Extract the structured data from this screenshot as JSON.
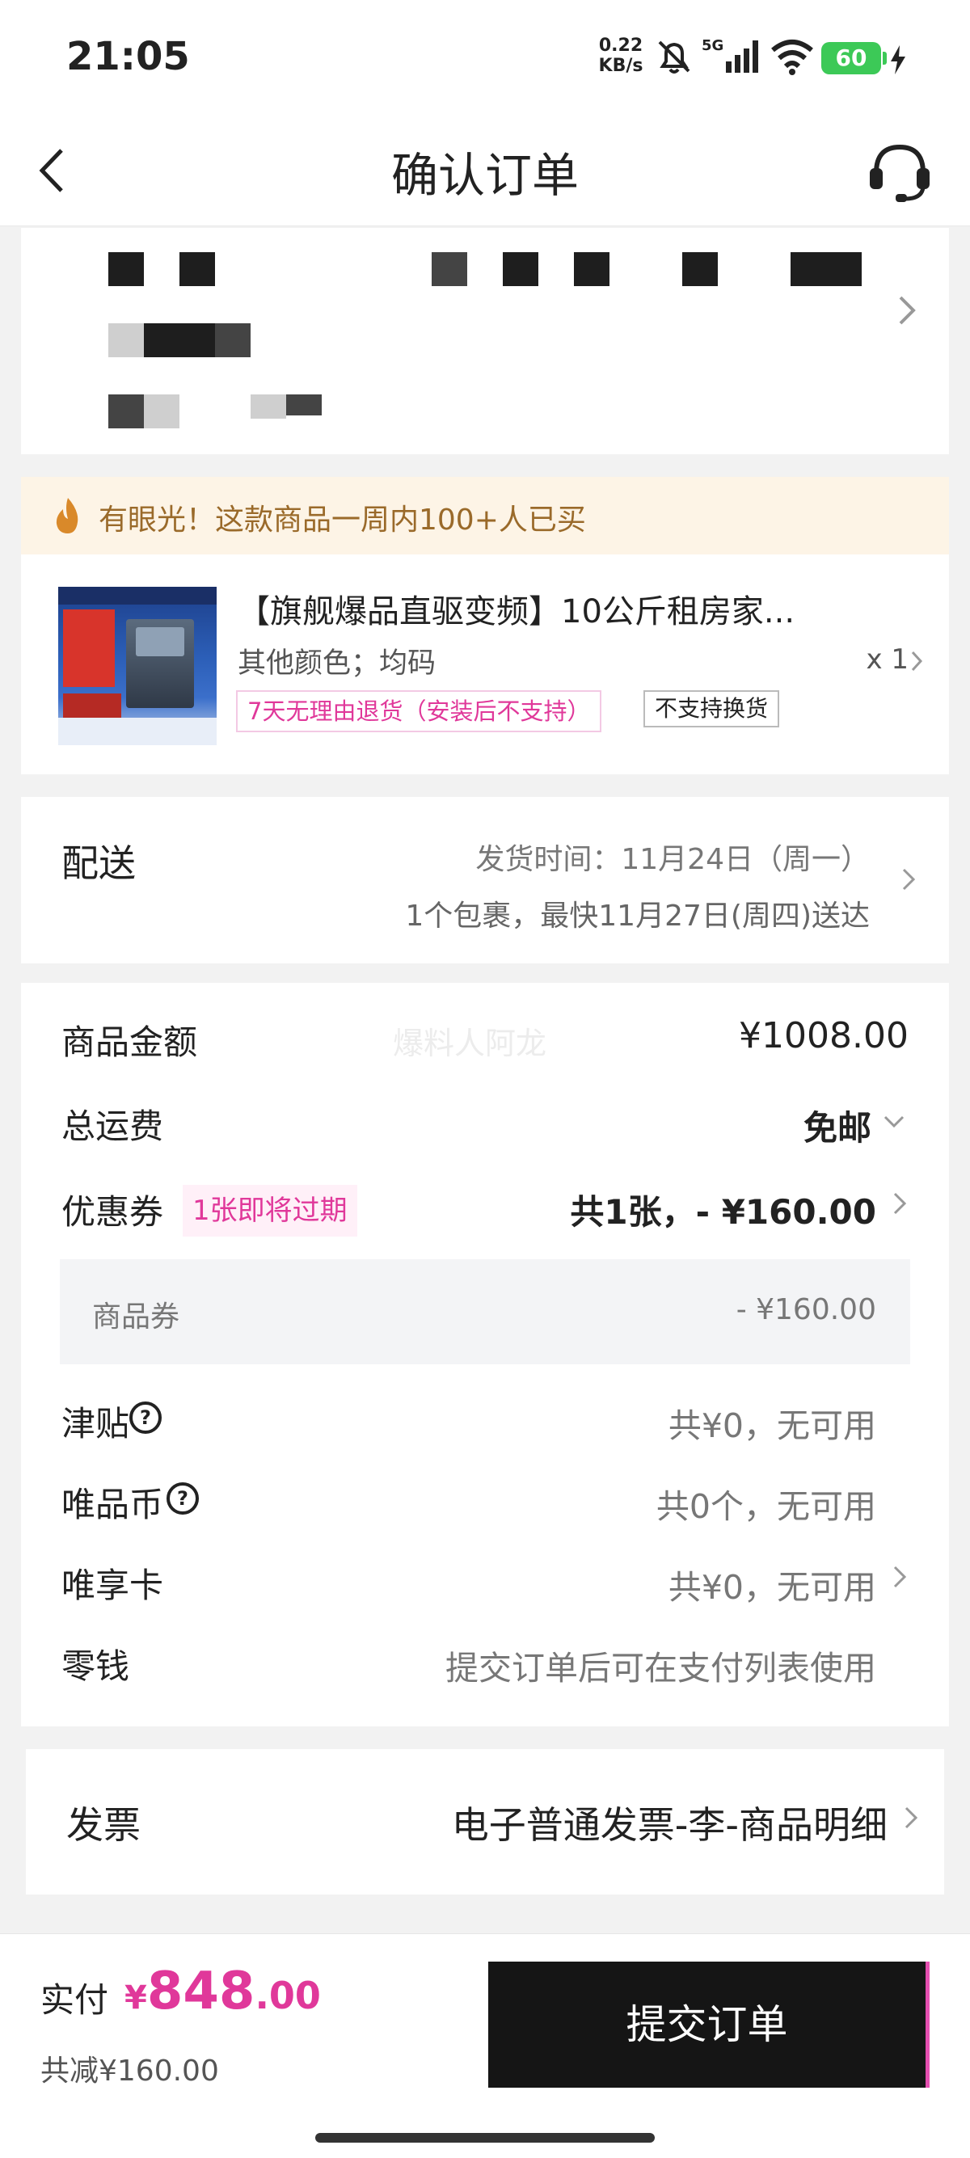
{
  "status_bar": {
    "time": "21:05",
    "net_speed_value": "0.22",
    "net_speed_unit": "KB/s",
    "network": "5G",
    "battery": "60"
  },
  "nav": {
    "title": "确认订单"
  },
  "hint": {
    "text": "有眼光！这款商品一周内100+人已买"
  },
  "product": {
    "title": "【旗舰爆品直驱变频】10公斤租房家...",
    "spec": "其他颜色；均码",
    "quantity": "x 1",
    "tag_return": "7天无理由退货（安装后不支持）",
    "tag_exchange": "不支持换货"
  },
  "delivery": {
    "label": "配送",
    "ship_time": "发货时间：11月24日（周一）",
    "eta": "1个包裹，最快11月27日(周四)送达"
  },
  "amounts": {
    "goods_label": "商品金额",
    "goods_value": "¥1008.00",
    "watermark": "爆料人阿龙",
    "shipping_label": "总运费",
    "shipping_value": "免邮",
    "coupon_label": "优惠券",
    "coupon_badge": "1张即将过期",
    "coupon_value": "共1张，- ¥160.00",
    "goods_coupon_label": "商品券",
    "goods_coupon_value": "- ¥160.00",
    "subsidy_label": "津贴",
    "subsidy_value": "共¥0，无可用",
    "coin_label": "唯品币",
    "coin_value": "共0个，无可用",
    "card_label": "唯享卡",
    "card_value": "共¥0，无可用",
    "change_label": "零钱",
    "change_value": "提交订单后可在支付列表使用"
  },
  "invoice": {
    "label": "发票",
    "value": "电子普通发票-李-商品明细"
  },
  "footer": {
    "pay_label": "实付",
    "currency": "¥",
    "amount_int": "848",
    "amount_dec": ".00",
    "saved": "共减¥160.00",
    "submit_label": "提交订单"
  },
  "colors": {
    "accent_pink": "#e0389a",
    "submit_bg": "#151515",
    "hint_bg": "#fdf4e6"
  }
}
